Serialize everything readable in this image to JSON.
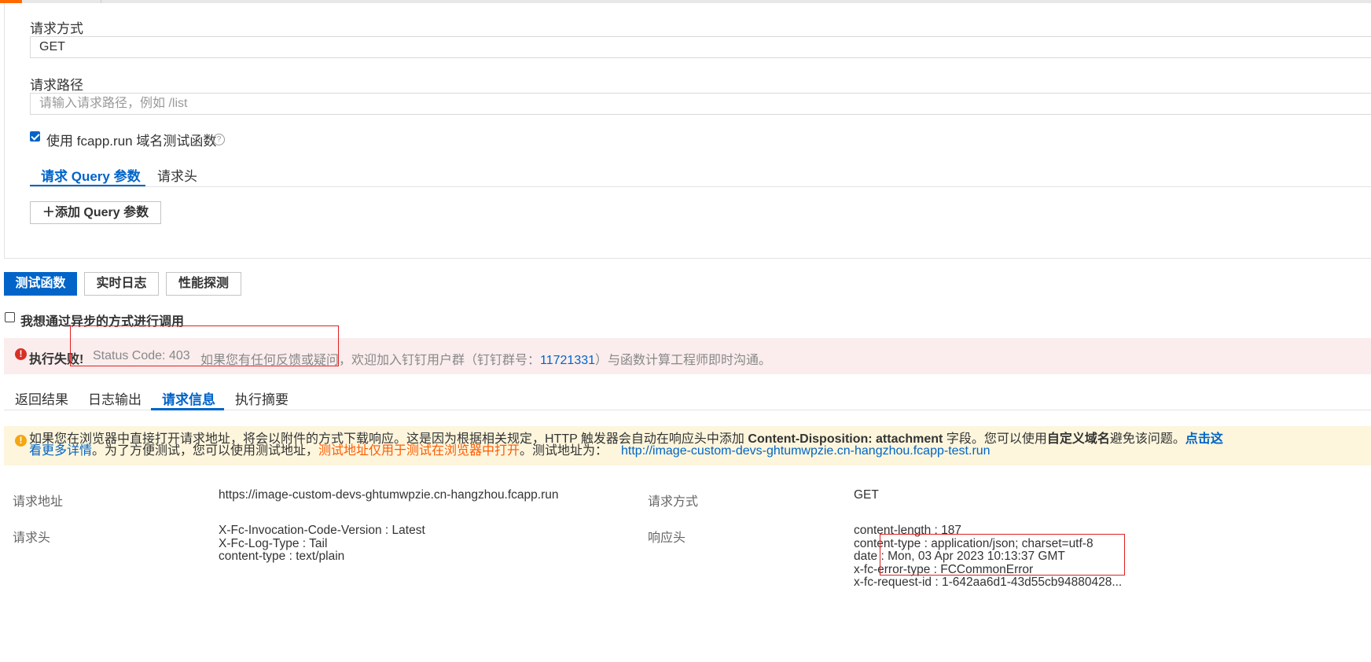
{
  "form": {
    "method_label": "请求方式",
    "method_value": "GET",
    "path_label": "请求路径",
    "path_placeholder": "请输入请求路径，例如 /list",
    "use_domain_label": "使用 fcapp.run 域名测试函数",
    "use_domain_checked": true,
    "help_icon": "?"
  },
  "param_tabs": [
    {
      "label": "请求 Query 参数",
      "active": true
    },
    {
      "label": "请求头",
      "active": false
    }
  ],
  "add_query_button": {
    "icon": "＋",
    "label": "添加 Query 参数"
  },
  "actions": {
    "test_button": "测试函数",
    "realtime_log_button": "实时日志",
    "perf_probe_button": "性能探测"
  },
  "async": {
    "label": "我想通过异步的方式进行调用",
    "checked": false
  },
  "error_alert": {
    "icon": "!",
    "title": "执行失败!",
    "status": "Status Code: 403",
    "message_prefix": "如果您有任何反馈或疑问，欢迎加入钉钉用户群（钉钉群号：",
    "group_number": "11721331",
    "message_suffix": "）与函数计算工程师即时沟通。"
  },
  "result_tabs": [
    {
      "label": "返回结果",
      "active": false
    },
    {
      "label": "日志输出",
      "active": false
    },
    {
      "label": "请求信息",
      "active": true
    },
    {
      "label": "执行摘要",
      "active": false
    }
  ],
  "warning_alert": {
    "icon": "!",
    "line1_part1": "如果您在浏览器中直接打开请求地址，将会以附件的方式下载响应。这是因为根据相关规定，HTTP 触发器会自动在响应头中添加 ",
    "line1_bold": "Content-Disposition: attachment",
    "line1_part2": " 字段。您可以使用",
    "line1_bold2": "自定义域名",
    "line1_part3": "避免该问题。",
    "line1_link": "点击这",
    "line2_link": "看更多详情",
    "line2_part1": "。为了方便测试，您可以使用测试地址，",
    "line2_orange": "测试地址仅用于测试在浏览器中打开",
    "line2_part2": "。测试地址为：",
    "test_url": "http://image-custom-devs-ghtumwpzie.cn-hangzhou.fcapp-test.run"
  },
  "request_info": {
    "url_label": "请求地址",
    "url_value": "https://image-custom-devs-ghtumwpzie.cn-hangzhou.fcapp.run",
    "method_label": "请求方式",
    "method_value": "GET",
    "req_headers_label": "请求头",
    "req_headers": [
      "X-Fc-Invocation-Code-Version : Latest",
      "X-Fc-Log-Type : Tail",
      "content-type : text/plain"
    ],
    "resp_headers_label": "响应头",
    "resp_headers": [
      "content-length : 187",
      "content-type : application/json; charset=utf-8",
      "date : Mon, 03 Apr 2023 10:13:37 GMT",
      "x-fc-error-type : FCCommonError",
      "x-fc-request-id : 1-642aa6d1-43d55cb94880428..."
    ]
  },
  "colors": {
    "primary": "#0064c8",
    "error": "#d93026",
    "warning": "#f3a712",
    "annotation": "#e02020"
  }
}
